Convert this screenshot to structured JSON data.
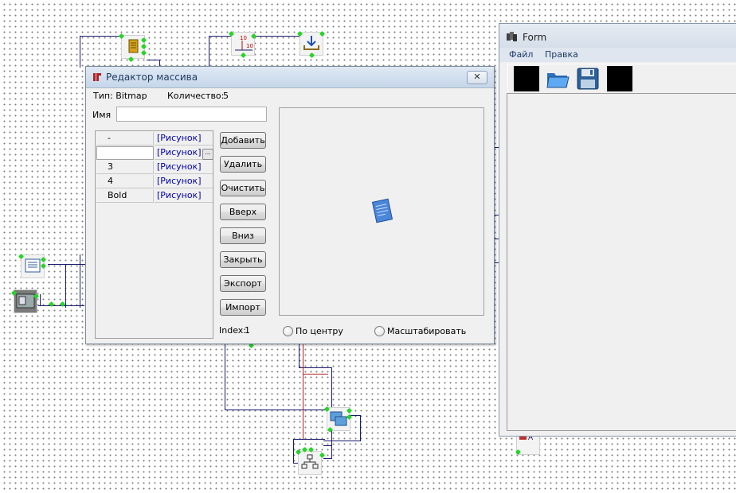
{
  "editor": {
    "title": "Редактор массива",
    "close_symbol": "✕",
    "type_label": "Тип: Bitmap",
    "count_label": "Количество:",
    "count_value": "5",
    "name_label": "Имя",
    "name_value": "",
    "rows": [
      {
        "name": "-",
        "value": "[Рисунок]"
      },
      {
        "name": "",
        "value": "[Рисунок]"
      },
      {
        "name": "3",
        "value": "[Рисунок]"
      },
      {
        "name": "4",
        "value": "[Рисунок]"
      },
      {
        "name": "Bold",
        "value": "[Рисунок]"
      }
    ],
    "ellipsis": "...",
    "buttons": {
      "add": "Добавить",
      "delete": "Удалить",
      "clear": "Очистить",
      "up": "Вверх",
      "down": "Вниз",
      "close": "Закрыть",
      "export": "Экспорт",
      "import": "Импорт"
    },
    "index_label": "Index:",
    "index_value": "1",
    "radio_center": "По центру",
    "radio_scale": "Масштабировать"
  },
  "form": {
    "title": "Form",
    "menu": [
      "Файл",
      "Правка"
    ],
    "toolbar_icons": [
      "black-square-icon",
      "folder-open-icon",
      "floppy-save-icon",
      "black-square-icon"
    ]
  },
  "colors": {
    "wire": "#1a1a6e",
    "wire_red": "#b02020",
    "pin": "#27d427",
    "link_text": "#0000a8"
  }
}
